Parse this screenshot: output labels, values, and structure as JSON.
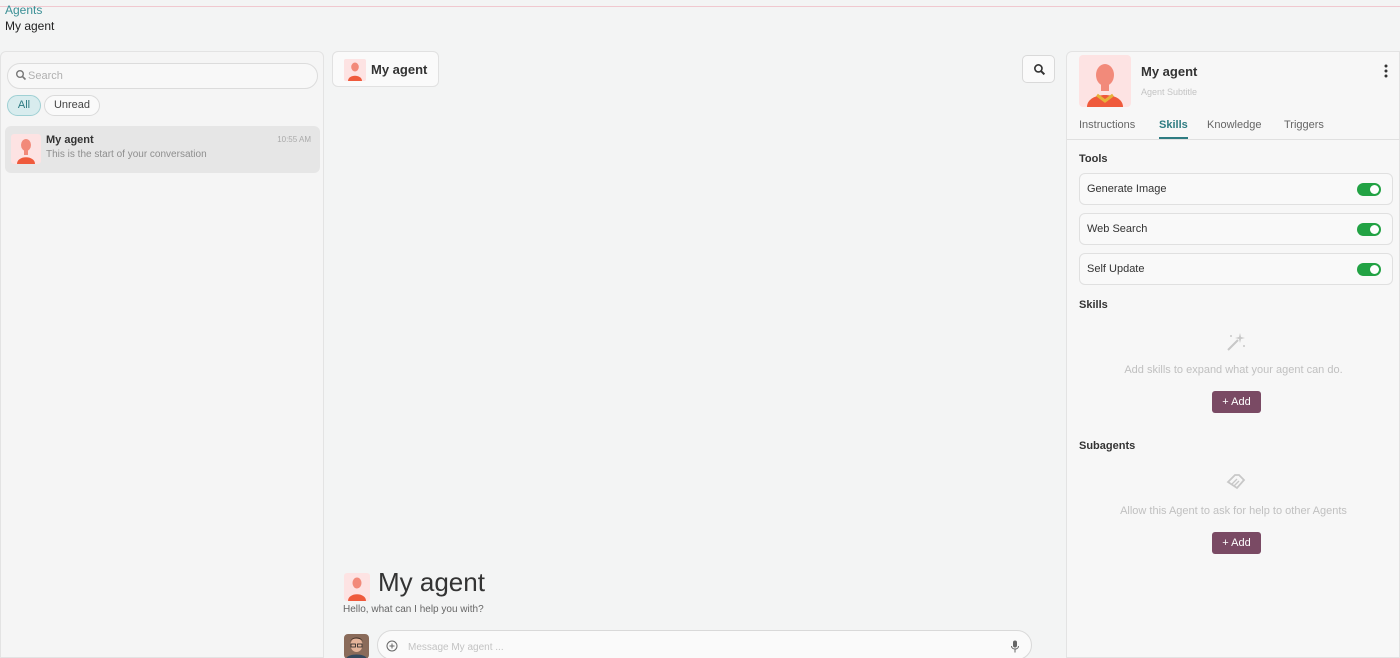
{
  "breadcrumb": {
    "parent": "Agents",
    "current": "My agent"
  },
  "sidebar": {
    "search_placeholder": "Search",
    "filters": {
      "all": "All",
      "unread": "Unread"
    },
    "conversation": {
      "name": "My agent",
      "time": "10:55 AM",
      "preview": "This is the start of your conversation"
    }
  },
  "chat": {
    "header_title": "My agent",
    "hero_title": "My agent",
    "hero_subtitle": "Hello, what can I help you with?",
    "composer_placeholder": "Message My agent ..."
  },
  "agent_panel": {
    "name": "My agent",
    "subtitle": "Agent Subtitle",
    "tabs": [
      "Instructions",
      "Skills",
      "Knowledge",
      "Triggers"
    ],
    "active_tab": "Skills",
    "tools_title": "Tools",
    "tools": [
      {
        "label": "Generate Image",
        "enabled": true
      },
      {
        "label": "Web Search",
        "enabled": true
      },
      {
        "label": "Self Update",
        "enabled": true
      }
    ],
    "skills_title": "Skills",
    "skills_empty": "Add skills to expand what your agent can do.",
    "subagents_title": "Subagents",
    "subagents_empty": "Allow this Agent to ask for help to other Agents",
    "add_label": "+ Add"
  },
  "colors": {
    "accent": "#2e7c82",
    "toggle_on": "#22a244",
    "add_button": "#7a4a64",
    "avatar_bg": "#fde3e3"
  }
}
